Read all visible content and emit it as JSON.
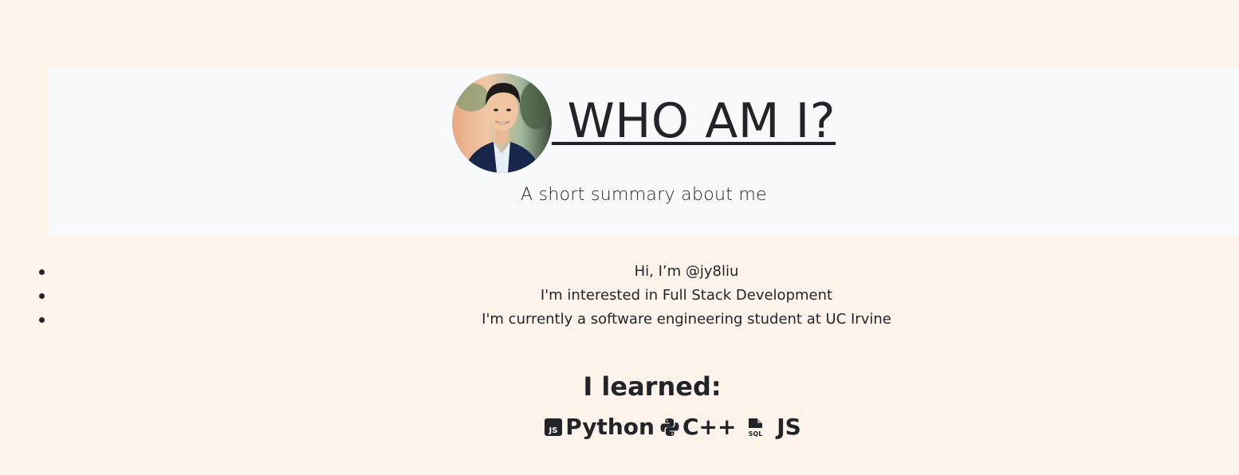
{
  "header": {
    "avatar_alt": "profile photo",
    "title": " WHO AM I?",
    "lead": "A short summary about me"
  },
  "about": {
    "items": [
      "Hi, I’m @jy8liu",
      "I'm interested in Full Stack Development",
      "I'm currently a software engineering student at UC Irvine"
    ]
  },
  "skills": {
    "heading": "I learned:",
    "items": [
      {
        "icon": "javascript-icon",
        "label": "Python"
      },
      {
        "icon": "python-icon",
        "label": "C++"
      },
      {
        "icon": "sql-file-icon",
        "label": " JS"
      }
    ]
  },
  "colors": {
    "page_background": "#fdf3ea",
    "jumbotron_background": "#f8f9fa",
    "text": "#212529"
  }
}
